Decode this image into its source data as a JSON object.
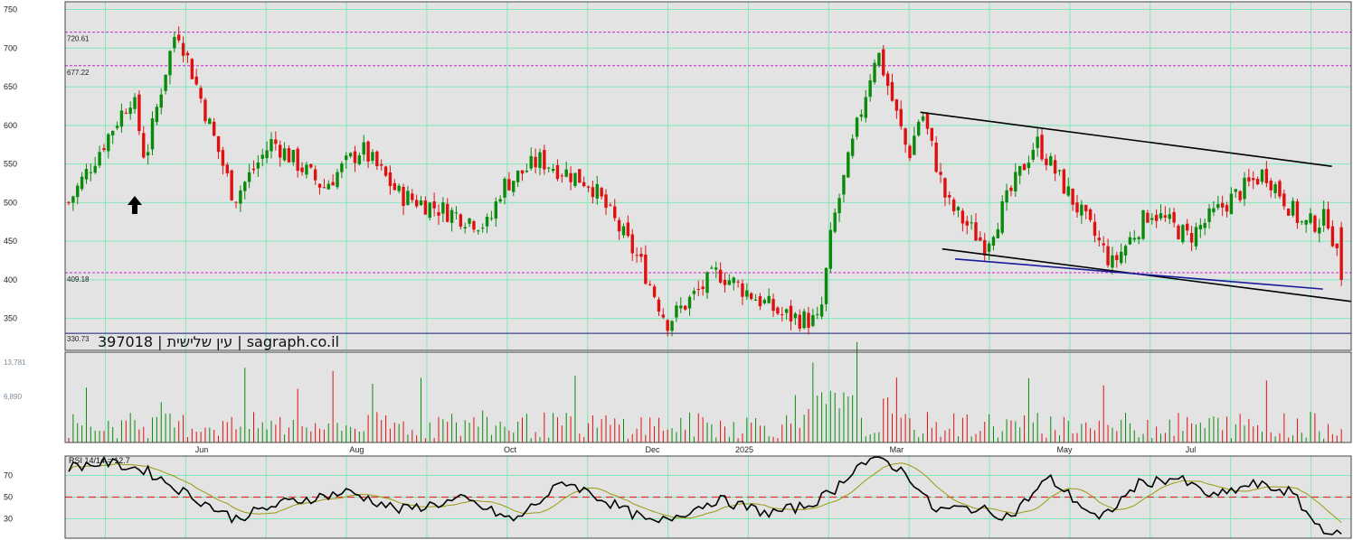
{
  "chart_data": [
    {
      "type": "candlestick",
      "title": "",
      "watermark": "עין שלישית | 397018 | sagraph.co.il",
      "ylim": [
        325,
        760
      ],
      "y_ticks": [
        350,
        400,
        450,
        500,
        550,
        600,
        650,
        700,
        750
      ],
      "x_labels": [
        "Jun",
        "Aug",
        "Oct",
        "Dec",
        "2025",
        "Mar",
        "May",
        "Jul"
      ],
      "grid": true,
      "up_color": "#0a8a0a",
      "down_color": "#e01010",
      "horizontal_levels": [
        {
          "label": "720.61",
          "value": 720.61
        },
        {
          "label": "677.22",
          "value": 677.22
        },
        {
          "label": "409.18",
          "value": 409.18
        },
        {
          "label": "330.73",
          "value": 330.73
        }
      ],
      "trendlines": [
        {
          "color": "#000000",
          "from": [
            0.665,
            617
          ],
          "to": [
            0.985,
            547
          ]
        },
        {
          "color": "#000000",
          "from": [
            0.682,
            440
          ],
          "to": [
            1.0,
            372
          ]
        },
        {
          "color": "#1a1a9a",
          "from": [
            0.692,
            427
          ],
          "to": [
            0.978,
            388
          ]
        }
      ],
      "segments": [
        {
          "from": 0.0,
          "to": 0.05,
          "start": 500,
          "end": 640
        },
        {
          "from": 0.05,
          "to": 0.06,
          "start": 640,
          "end": 555
        },
        {
          "from": 0.06,
          "to": 0.075,
          "start": 555,
          "end": 665
        },
        {
          "from": 0.075,
          "to": 0.085,
          "start": 665,
          "end": 728
        },
        {
          "from": 0.085,
          "to": 0.13,
          "start": 728,
          "end": 505
        },
        {
          "from": 0.13,
          "to": 0.16,
          "start": 505,
          "end": 580
        },
        {
          "from": 0.16,
          "to": 0.2,
          "start": 580,
          "end": 520
        },
        {
          "from": 0.2,
          "to": 0.23,
          "start": 520,
          "end": 570
        },
        {
          "from": 0.23,
          "to": 0.26,
          "start": 570,
          "end": 510
        },
        {
          "from": 0.26,
          "to": 0.33,
          "start": 510,
          "end": 470
        },
        {
          "from": 0.33,
          "to": 0.34,
          "start": 470,
          "end": 520
        },
        {
          "from": 0.34,
          "to": 0.37,
          "start": 520,
          "end": 555
        },
        {
          "from": 0.37,
          "to": 0.41,
          "start": 555,
          "end": 525
        },
        {
          "from": 0.41,
          "to": 0.45,
          "start": 525,
          "end": 420
        },
        {
          "from": 0.45,
          "to": 0.47,
          "start": 420,
          "end": 345
        },
        {
          "from": 0.47,
          "to": 0.51,
          "start": 345,
          "end": 410
        },
        {
          "from": 0.51,
          "to": 0.56,
          "start": 410,
          "end": 355
        },
        {
          "from": 0.56,
          "to": 0.59,
          "start": 355,
          "end": 345
        },
        {
          "from": 0.59,
          "to": 0.6,
          "start": 345,
          "end": 470
        },
        {
          "from": 0.6,
          "to": 0.635,
          "start": 470,
          "end": 700
        },
        {
          "from": 0.635,
          "to": 0.66,
          "start": 700,
          "end": 560
        },
        {
          "from": 0.66,
          "to": 0.67,
          "start": 560,
          "end": 620
        },
        {
          "from": 0.67,
          "to": 0.69,
          "start": 620,
          "end": 500
        },
        {
          "from": 0.69,
          "to": 0.72,
          "start": 500,
          "end": 445
        },
        {
          "from": 0.72,
          "to": 0.76,
          "start": 445,
          "end": 580
        },
        {
          "from": 0.76,
          "to": 0.82,
          "start": 580,
          "end": 420
        },
        {
          "from": 0.82,
          "to": 0.85,
          "start": 420,
          "end": 490
        },
        {
          "from": 0.85,
          "to": 0.88,
          "start": 490,
          "end": 455
        },
        {
          "from": 0.88,
          "to": 0.91,
          "start": 455,
          "end": 500
        },
        {
          "from": 0.91,
          "to": 0.94,
          "start": 500,
          "end": 540
        },
        {
          "from": 0.94,
          "to": 0.97,
          "start": 540,
          "end": 470
        },
        {
          "from": 0.97,
          "to": 0.99,
          "start": 470,
          "end": 480
        },
        {
          "from": 0.99,
          "to": 1.0,
          "start": 480,
          "end": 400
        }
      ],
      "last_close": 400
    },
    {
      "type": "bar",
      "title": "",
      "y_ticks": [
        "13,781",
        "6,890"
      ],
      "ylim": [
        0,
        13781
      ],
      "up_color": "#0a8a0a",
      "down_color": "#e01010"
    },
    {
      "type": "line",
      "title": "RSI 14/14 = 12.7",
      "ylim": [
        12,
        88
      ],
      "y_ticks": [
        30,
        50,
        70
      ],
      "reference_line": 50,
      "series": [
        {
          "color": "#000000"
        },
        {
          "color": "#9a9a10"
        }
      ],
      "rsi_path": [
        [
          0.0,
          78
        ],
        [
          0.03,
          82
        ],
        [
          0.06,
          75
        ],
        [
          0.09,
          55
        ],
        [
          0.13,
          30
        ],
        [
          0.17,
          45
        ],
        [
          0.22,
          55
        ],
        [
          0.26,
          38
        ],
        [
          0.31,
          48
        ],
        [
          0.35,
          28
        ],
        [
          0.39,
          65
        ],
        [
          0.43,
          42
        ],
        [
          0.46,
          25
        ],
        [
          0.51,
          48
        ],
        [
          0.55,
          35
        ],
        [
          0.58,
          42
        ],
        [
          0.6,
          55
        ],
        [
          0.62,
          80
        ],
        [
          0.64,
          85
        ],
        [
          0.66,
          70
        ],
        [
          0.68,
          38
        ],
        [
          0.71,
          40
        ],
        [
          0.74,
          32
        ],
        [
          0.77,
          68
        ],
        [
          0.79,
          48
        ],
        [
          0.81,
          28
        ],
        [
          0.84,
          62
        ],
        [
          0.87,
          68
        ],
        [
          0.9,
          50
        ],
        [
          0.93,
          62
        ],
        [
          0.96,
          55
        ],
        [
          0.98,
          25
        ],
        [
          1.0,
          12.7
        ]
      ]
    }
  ]
}
